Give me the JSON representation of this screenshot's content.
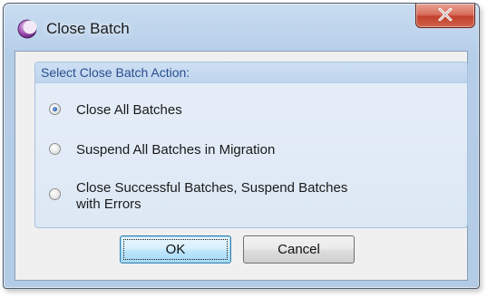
{
  "window": {
    "title": "Close Batch",
    "app_icon": "moon-crescent-icon",
    "close_icon": "close-x-icon",
    "close_button_color": "#c3412c"
  },
  "group": {
    "title": "Select Close Batch Action:",
    "options": [
      {
        "label": "Close All Batches",
        "checked": true
      },
      {
        "label": "Suspend All Batches in Migration",
        "checked": false
      },
      {
        "label_line1": "Close Successful Batches, Suspend Batches",
        "label_line2": "with Errors",
        "checked": false
      }
    ]
  },
  "buttons": {
    "ok_label": "OK",
    "cancel_label": "Cancel"
  },
  "colors": {
    "title_bar": "#bcd3ec",
    "group_title_text": "#2a4d8f",
    "default_button_border": "#3c7fb1"
  }
}
